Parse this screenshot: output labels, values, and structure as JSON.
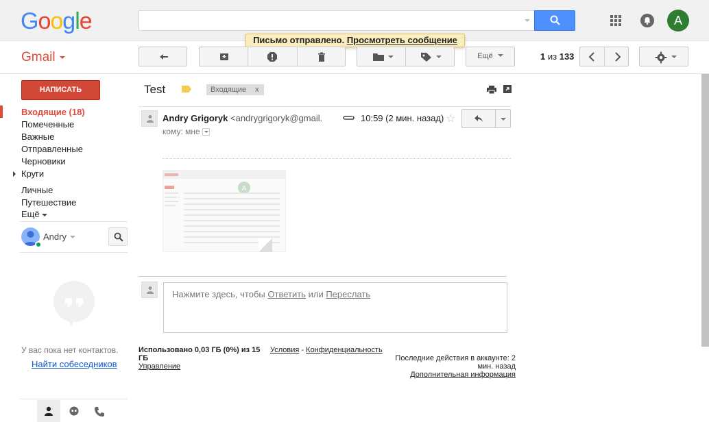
{
  "header": {
    "logo_letters": [
      {
        "ch": "G",
        "color": "#4285f4"
      },
      {
        "ch": "o",
        "color": "#ea4335"
      },
      {
        "ch": "o",
        "color": "#fbbc05"
      },
      {
        "ch": "g",
        "color": "#4285f4"
      },
      {
        "ch": "l",
        "color": "#34a853"
      },
      {
        "ch": "e",
        "color": "#ea4335"
      }
    ],
    "search_value": "",
    "avatar_letter": "A"
  },
  "notification": {
    "text": "Письмо отправлено.",
    "link": "Просмотреть сообщение"
  },
  "toolbar": {
    "app_label": "Gmail",
    "more_label": "Ещё",
    "pager_current": "1",
    "pager_sep": "из",
    "pager_total": "133"
  },
  "sidebar": {
    "compose_label": "НАПИСАТЬ",
    "items": [
      {
        "label": "Входящие (18)"
      },
      {
        "label": "Помеченные"
      },
      {
        "label": "Важные"
      },
      {
        "label": "Отправленные"
      },
      {
        "label": "Черновики"
      },
      {
        "label": "Круги"
      },
      {
        "label": "Личные"
      },
      {
        "label": "Путешествие"
      },
      {
        "label": "Ещё"
      }
    ],
    "user_name": "Andry",
    "no_contacts": "У вас пока нет контактов.",
    "find_contacts": "Найти собеседников"
  },
  "message": {
    "subject": "Test",
    "label_chip": "Входящие",
    "label_chip_close": "x",
    "sender_name": "Andry Grigoryk",
    "sender_email": "<andrygrigoryk@gmail.com>",
    "time": "10:59 (2 мин. назад)",
    "to_label": "кому: мне",
    "reply_prompt": "Нажмите здесь, чтобы",
    "reply_link": "Ответить",
    "reply_or": "или",
    "forward_link": "Переслать"
  },
  "footer": {
    "usage": "Использовано 0,03 ГБ (0%) из 15 ГБ",
    "manage": "Управление",
    "terms": "Условия",
    "terms_sep": "-",
    "privacy": "Конфиденциальность",
    "last_activity": "Последние действия в аккаунте: 2 мин. назад",
    "more_info": "Дополнительная информация"
  }
}
